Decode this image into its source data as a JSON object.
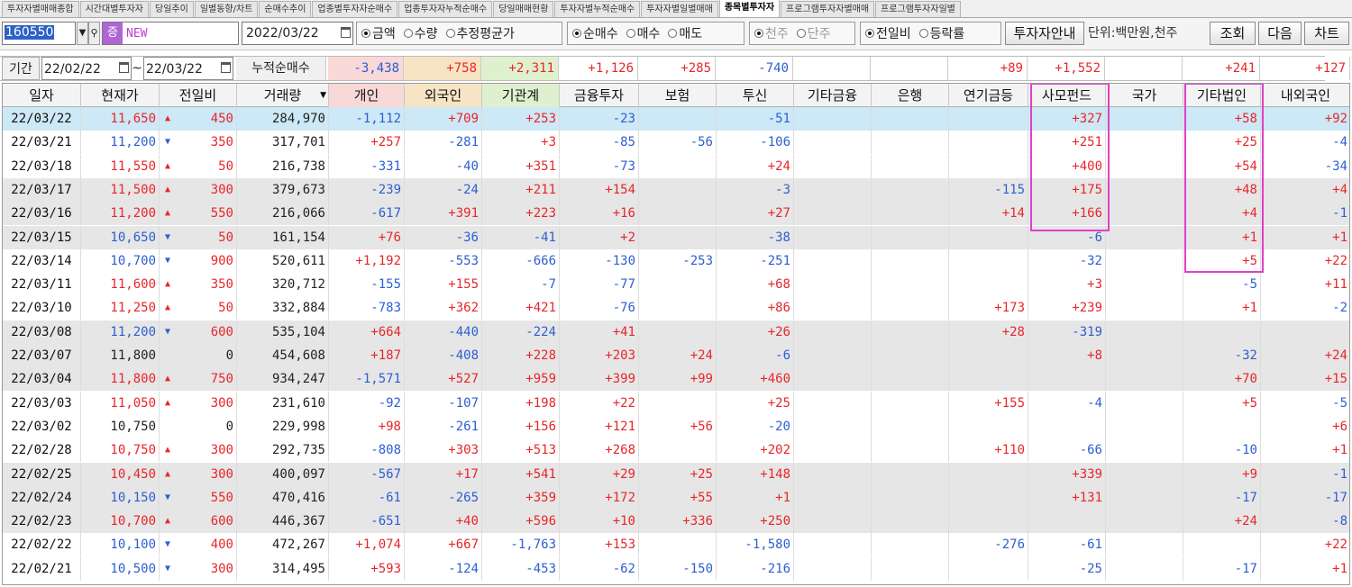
{
  "tabs": [
    "투자자별매매종합",
    "시간대별투자자",
    "당일추이",
    "일별동향/차트",
    "순매수추이",
    "업종별투자자순매수",
    "업종투자자누적순매수",
    "당일매매현황",
    "투자자별누적순매수",
    "투자자별일별매매",
    "종목별투자자",
    "프로그램투자자별매매",
    "프로그램투자자일별"
  ],
  "active_tab": 10,
  "toolbar": {
    "code": "160550",
    "badge": "증",
    "name": "NEW",
    "date": "2022/03/22",
    "radio1": [
      {
        "label": "금액",
        "on": true
      },
      {
        "label": "수량",
        "on": false
      },
      {
        "label": "추정평균가",
        "on": false
      }
    ],
    "radio2": [
      {
        "label": "순매수",
        "on": true
      },
      {
        "label": "매수",
        "on": false
      },
      {
        "label": "매도",
        "on": false
      }
    ],
    "radio3": [
      {
        "label": "천주",
        "on": true,
        "disabled": true
      },
      {
        "label": "단주",
        "on": false,
        "disabled": true
      }
    ],
    "radio4": [
      {
        "label": "전일비",
        "on": true
      },
      {
        "label": "등락률",
        "on": false
      }
    ],
    "guide_btn": "투자자안내",
    "unit": "단위:백만원,천주",
    "query_btn": "조회",
    "next_btn": "다음",
    "chart_btn": "차트"
  },
  "summary": {
    "period_label": "기간",
    "start": "22/02/22",
    "tilde": "~",
    "end": "22/03/22",
    "cum_label": "누적순매수",
    "values": [
      "-3,438",
      "+758",
      "+2,311",
      "+1,126",
      "+285",
      "-740",
      "",
      "",
      "+89",
      "+1,552",
      "",
      "+241",
      "+127"
    ]
  },
  "headers": [
    "일자",
    "현재가",
    "전일비",
    "거래량",
    "개인",
    "외국인",
    "기관계",
    "금융투자",
    "보험",
    "투신",
    "기타금융",
    "은행",
    "연기금등",
    "사모펀드",
    "국가",
    "기타법인",
    "내외국인"
  ],
  "rows": [
    {
      "date": "22/03/22",
      "price": "11,650",
      "dir": "up",
      "chg": "450",
      "vol": "284,970",
      "v": [
        "-1,112",
        "+709",
        "+253",
        "-23",
        "",
        "-51",
        "",
        "",
        "",
        "+327",
        "",
        "+58",
        "+92"
      ]
    },
    {
      "date": "22/03/21",
      "price": "11,200",
      "dir": "down",
      "chg": "350",
      "vol": "317,701",
      "v": [
        "+257",
        "-281",
        "+3",
        "-85",
        "-56",
        "-106",
        "",
        "",
        "",
        "+251",
        "",
        "+25",
        "-4"
      ]
    },
    {
      "date": "22/03/18",
      "price": "11,550",
      "dir": "up",
      "chg": "50",
      "vol": "216,738",
      "v": [
        "-331",
        "-40",
        "+351",
        "-73",
        "",
        "+24",
        "",
        "",
        "",
        "+400",
        "",
        "+54",
        "-34"
      ]
    },
    {
      "date": "22/03/17",
      "price": "11,500",
      "dir": "up",
      "chg": "300",
      "vol": "379,673",
      "v": [
        "-239",
        "-24",
        "+211",
        "+154",
        "",
        "-3",
        "",
        "",
        "-115",
        "+175",
        "",
        "+48",
        "+4"
      ]
    },
    {
      "date": "22/03/16",
      "price": "11,200",
      "dir": "up",
      "chg": "550",
      "vol": "216,066",
      "v": [
        "-617",
        "+391",
        "+223",
        "+16",
        "",
        "+27",
        "",
        "",
        "+14",
        "+166",
        "",
        "+4",
        "-1"
      ]
    },
    {
      "date": "22/03/15",
      "price": "10,650",
      "dir": "down",
      "chg": "50",
      "vol": "161,154",
      "v": [
        "+76",
        "-36",
        "-41",
        "+2",
        "",
        "-38",
        "",
        "",
        "",
        "-6",
        "",
        "+1",
        "+1"
      ]
    },
    {
      "date": "22/03/14",
      "price": "10,700",
      "dir": "down",
      "chg": "900",
      "vol": "520,611",
      "v": [
        "+1,192",
        "-553",
        "-666",
        "-130",
        "-253",
        "-251",
        "",
        "",
        "",
        "-32",
        "",
        "+5",
        "+22"
      ]
    },
    {
      "date": "22/03/11",
      "price": "11,600",
      "dir": "up",
      "chg": "350",
      "vol": "320,712",
      "v": [
        "-155",
        "+155",
        "-7",
        "-77",
        "",
        "+68",
        "",
        "",
        "",
        "+3",
        "",
        "-5",
        "+11"
      ]
    },
    {
      "date": "22/03/10",
      "price": "11,250",
      "dir": "up",
      "chg": "50",
      "vol": "332,884",
      "v": [
        "-783",
        "+362",
        "+421",
        "-76",
        "",
        "+86",
        "",
        "",
        "+173",
        "+239",
        "",
        "+1",
        "-2"
      ]
    },
    {
      "date": "22/03/08",
      "price": "11,200",
      "dir": "down",
      "chg": "600",
      "vol": "535,104",
      "v": [
        "+664",
        "-440",
        "-224",
        "+41",
        "",
        "+26",
        "",
        "",
        "+28",
        "-319",
        "",
        "",
        ""
      ]
    },
    {
      "date": "22/03/07",
      "price": "11,800",
      "dir": "none",
      "chg": "0",
      "vol": "454,608",
      "v": [
        "+187",
        "-408",
        "+228",
        "+203",
        "+24",
        "-6",
        "",
        "",
        "",
        "+8",
        "",
        "-32",
        "+24"
      ]
    },
    {
      "date": "22/03/04",
      "price": "11,800",
      "dir": "up",
      "chg": "750",
      "vol": "934,247",
      "v": [
        "-1,571",
        "+527",
        "+959",
        "+399",
        "+99",
        "+460",
        "",
        "",
        "",
        "",
        "",
        "+70",
        "+15"
      ]
    },
    {
      "date": "22/03/03",
      "price": "11,050",
      "dir": "up",
      "chg": "300",
      "vol": "231,610",
      "v": [
        "-92",
        "-107",
        "+198",
        "+22",
        "",
        "+25",
        "",
        "",
        "+155",
        "-4",
        "",
        "+5",
        "-5"
      ]
    },
    {
      "date": "22/03/02",
      "price": "10,750",
      "dir": "none",
      "chg": "0",
      "vol": "229,998",
      "v": [
        "+98",
        "-261",
        "+156",
        "+121",
        "+56",
        "-20",
        "",
        "",
        "",
        "",
        "",
        "",
        "+6"
      ]
    },
    {
      "date": "22/02/28",
      "price": "10,750",
      "dir": "up",
      "chg": "300",
      "vol": "292,735",
      "v": [
        "-808",
        "+303",
        "+513",
        "+268",
        "",
        "+202",
        "",
        "",
        "+110",
        "-66",
        "",
        "-10",
        "+1"
      ]
    },
    {
      "date": "22/02/25",
      "price": "10,450",
      "dir": "up",
      "chg": "300",
      "vol": "400,097",
      "v": [
        "-567",
        "+17",
        "+541",
        "+29",
        "+25",
        "+148",
        "",
        "",
        "",
        "+339",
        "",
        "+9",
        "-1"
      ]
    },
    {
      "date": "22/02/24",
      "price": "10,150",
      "dir": "down",
      "chg": "550",
      "vol": "470,416",
      "v": [
        "-61",
        "-265",
        "+359",
        "+172",
        "+55",
        "+1",
        "",
        "",
        "",
        "+131",
        "",
        "-17",
        "-17"
      ]
    },
    {
      "date": "22/02/23",
      "price": "10,700",
      "dir": "up",
      "chg": "600",
      "vol": "446,367",
      "v": [
        "-651",
        "+40",
        "+596",
        "+10",
        "+336",
        "+250",
        "",
        "",
        "",
        "",
        "",
        "+24",
        "-8"
      ]
    },
    {
      "date": "22/02/22",
      "price": "10,100",
      "dir": "down",
      "chg": "400",
      "vol": "472,267",
      "v": [
        "+1,074",
        "+667",
        "-1,763",
        "+153",
        "",
        "-1,580",
        "",
        "",
        "-276",
        "-61",
        "",
        "",
        "+22"
      ]
    },
    {
      "date": "22/02/21",
      "price": "10,500",
      "dir": "down",
      "chg": "300",
      "vol": "314,495",
      "v": [
        "+593",
        "-124",
        "-453",
        "-62",
        "-150",
        "-216",
        "",
        "",
        "",
        "-25",
        "",
        "-17",
        "+1"
      ]
    }
  ],
  "colors": {
    "up": "#e8262a",
    "down": "#2c5fd1",
    "selected_row": "#cde8f6",
    "gray_row": "#e6e6e6",
    "highlight_box": "#e040c8",
    "sum_pink": "#f9d8d8",
    "sum_orange": "#f6e4c4",
    "sum_green": "#dff0cf"
  }
}
